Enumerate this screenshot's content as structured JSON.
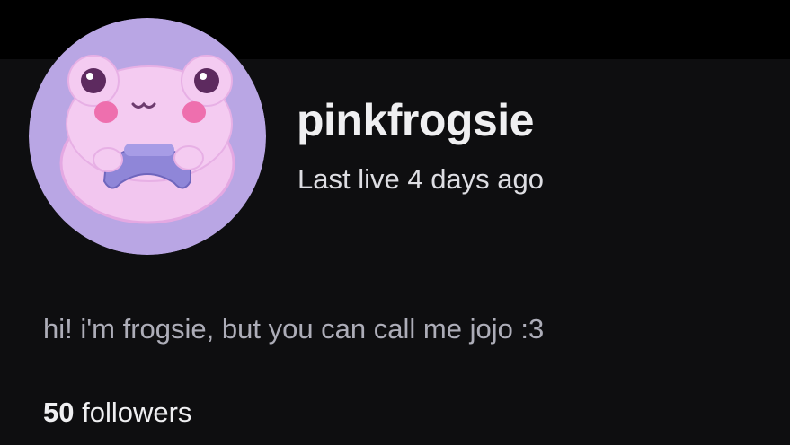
{
  "profile": {
    "username": "pinkfrogsie",
    "last_live": "Last live 4 days ago",
    "bio": "hi! i'm frogsie, but you can call me jojo :3",
    "followers_count": "50",
    "followers_label": "followers"
  },
  "avatar": {
    "icon": "frog-mascot-avatar"
  },
  "colors": {
    "background": "#0e0e10",
    "top_bar": "#000000",
    "avatar_bg": "#b9a6e4",
    "frog_body": "#f1c4ee",
    "cheeks": "#ee6fae",
    "controller": "#8f86d8"
  }
}
